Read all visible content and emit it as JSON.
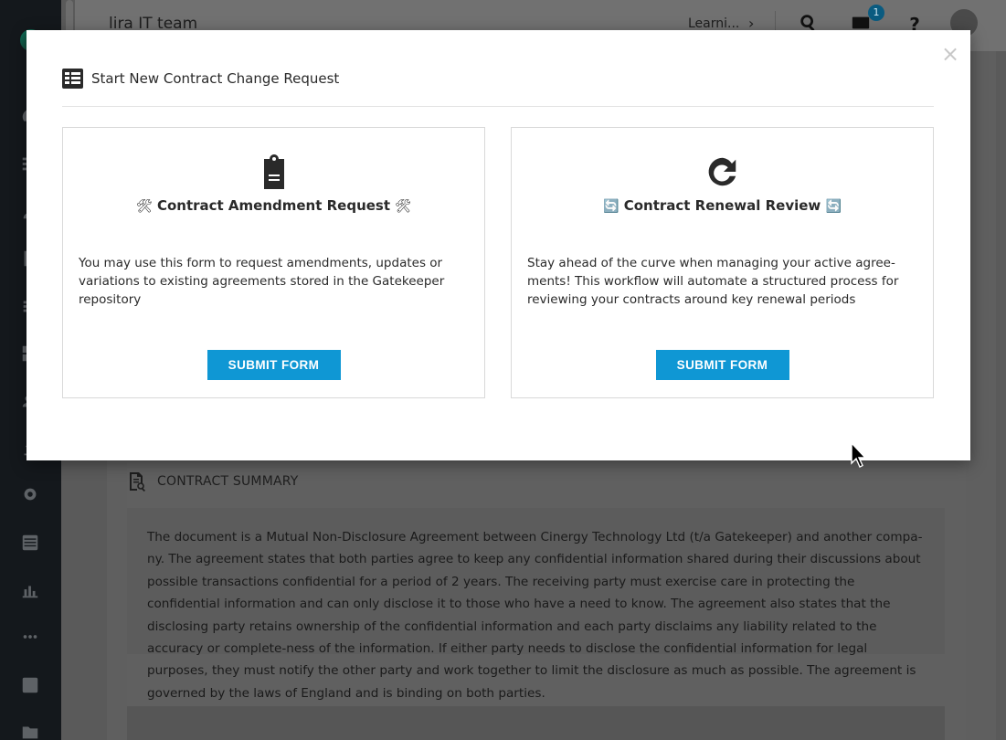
{
  "app": {
    "team_name": "lira IT team",
    "learning_label": "Learni...",
    "notification_count": "1"
  },
  "modal": {
    "title": "Start New Contract Change Request",
    "close_glyph": "×",
    "forms": [
      {
        "title_prefix_emoji": "🛠",
        "title": "Contract Amendment Request",
        "title_suffix_emoji": "🛠",
        "description": "You may use this form to request amendments, updates or variations to existing agreements stored in the Gatekeeper repository",
        "button_label": "SUBMIT FORM"
      },
      {
        "title_prefix_emoji": "🔄",
        "title": "Contract Renewal Review",
        "title_suffix_emoji": "🔄",
        "description": "Stay ahead of the curve when managing your active agree-ments! This workflow will automate a structured process for reviewing your contracts around key renewal periods",
        "button_label": "SUBMIT FORM"
      }
    ]
  },
  "summary": {
    "title": "CONTRACT SUMMARY",
    "text": "The document is a Mutual Non-Disclosure Agreement between Cinergy Technology Ltd (t/a Gatekeeper) and another compa-ny. The agreement states that both parties agree to keep any confidential information shared during their discussions about possible transactions confidential for a period of 2 years. The receiving party must exercise care in protecting the confidential information and can only disclose it to those who have a need to know. The agreement also states that the disclosing party retains ownership of the confidential information and each party disclaims any liability related to the accuracy or complete-ness of the information. If either party needs to disclose the confidential information for legal purposes, they must notify the other party and work together to limit the disclosure as much as possible. The agreement is governed by the laws of England and is binding on both parties."
  },
  "colors": {
    "accent": "#0f97d4",
    "sidebar": "#14181c"
  },
  "icons": {
    "modal_header": "table-icon",
    "form1": "clipboard-icon",
    "form2": "refresh-icon",
    "summary": "document-search-icon"
  }
}
